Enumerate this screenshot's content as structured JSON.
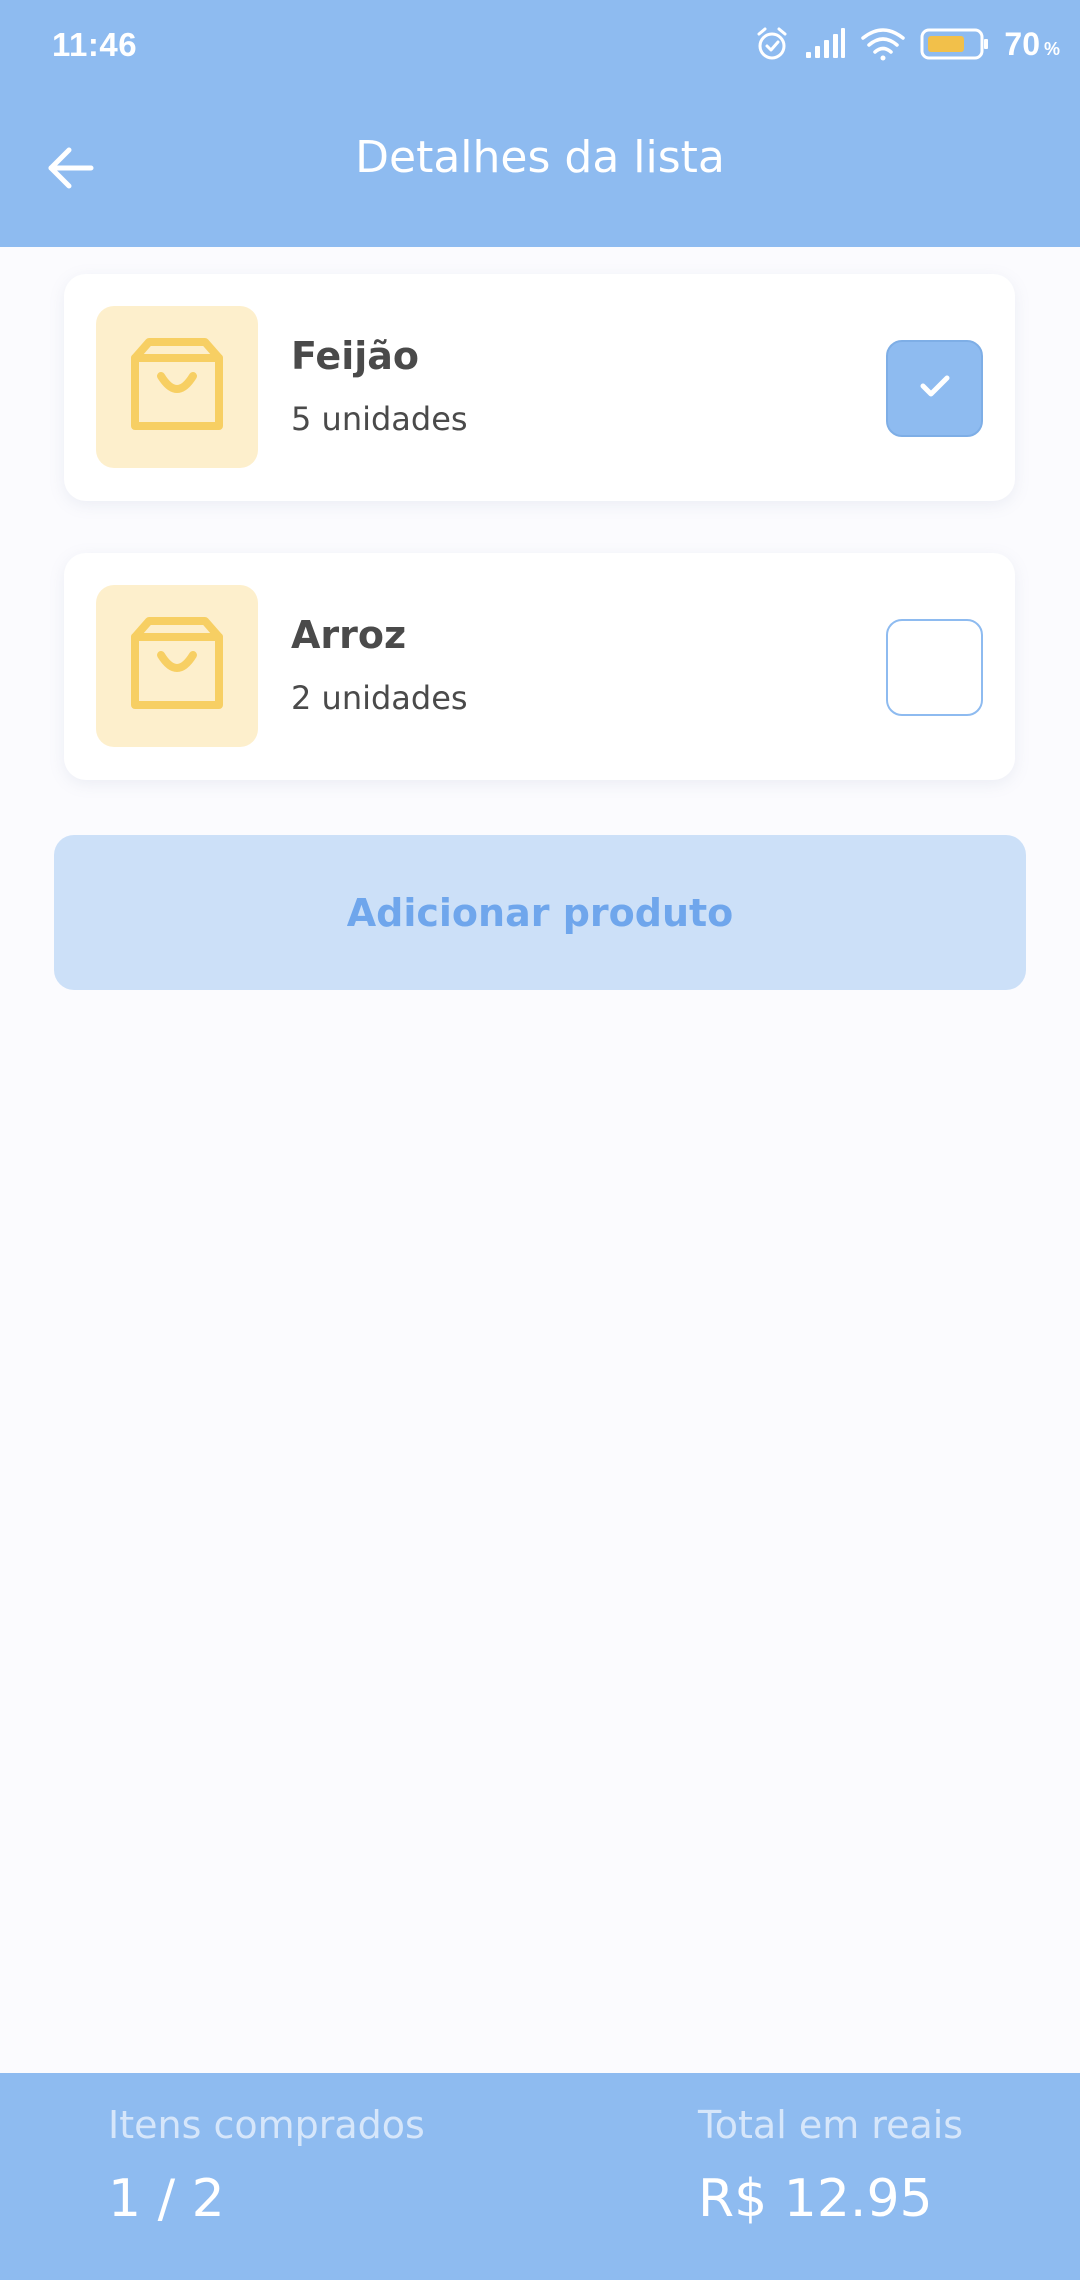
{
  "status_bar": {
    "time": "11:46",
    "battery_percent": "70",
    "battery_unit": "%",
    "icons": [
      "alarm-icon",
      "signal-icon",
      "wifi-icon",
      "battery-icon"
    ]
  },
  "header": {
    "title": "Detalhes da lista",
    "back_icon": "arrow-left-icon"
  },
  "items": [
    {
      "name": "Feijão",
      "quantity": "5 unidades",
      "checked": true,
      "icon": "shopping-bag-icon"
    },
    {
      "name": "Arroz",
      "quantity": "2 unidades",
      "checked": false,
      "icon": "shopping-bag-icon"
    }
  ],
  "add_product": {
    "label": "Adicionar produto"
  },
  "footer": {
    "purchased_label": "Itens comprados",
    "purchased_value": "1 / 2",
    "total_label": "Total em reais",
    "total_value": "R$ 12.95"
  },
  "colors": {
    "primary": "#8ebbf0",
    "item_thumb_bg": "#fdefcc",
    "item_icon": "#f7cf63",
    "button_bg": "#cce0f8",
    "button_text": "#6fa6ec"
  }
}
